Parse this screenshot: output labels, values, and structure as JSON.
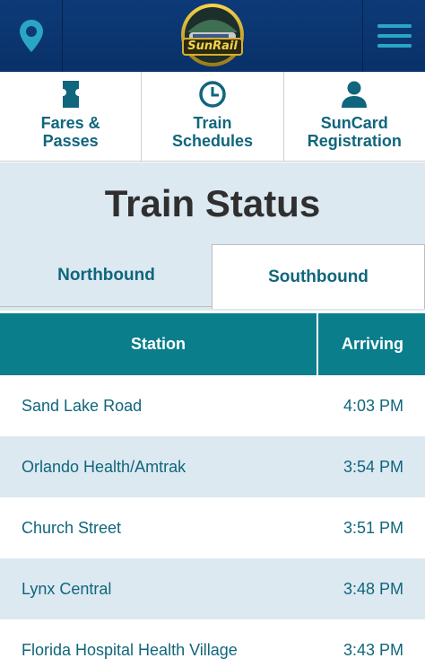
{
  "header": {
    "logo_text": "SunRail",
    "location_icon": "location-pin-icon",
    "menu_icon": "hamburger-menu-icon"
  },
  "nav": [
    {
      "label": "Fares &\nPasses",
      "icon": "ticket-icon"
    },
    {
      "label": "Train\nSchedules",
      "icon": "clock-icon"
    },
    {
      "label": "SunCard\nRegistration",
      "icon": "person-icon"
    }
  ],
  "page": {
    "title": "Train Status"
  },
  "tabs": [
    {
      "label": "Northbound",
      "selected": false
    },
    {
      "label": "Southbound",
      "selected": true
    }
  ],
  "table": {
    "headers": {
      "station": "Station",
      "arriving": "Arriving"
    },
    "rows": [
      {
        "station": "Sand Lake Road",
        "arriving": "4:03 PM"
      },
      {
        "station": "Orlando Health/Amtrak",
        "arriving": "3:54 PM"
      },
      {
        "station": "Church Street",
        "arriving": "3:51 PM"
      },
      {
        "station": "Lynx Central",
        "arriving": "3:48 PM"
      },
      {
        "station": "Florida Hospital Health Village",
        "arriving": "3:43 PM"
      }
    ]
  },
  "colors": {
    "header_bg": "#0c3a78",
    "accent_teal": "#0b7e8c",
    "text_teal": "#10667c",
    "row_alt": "#dde9f1"
  }
}
